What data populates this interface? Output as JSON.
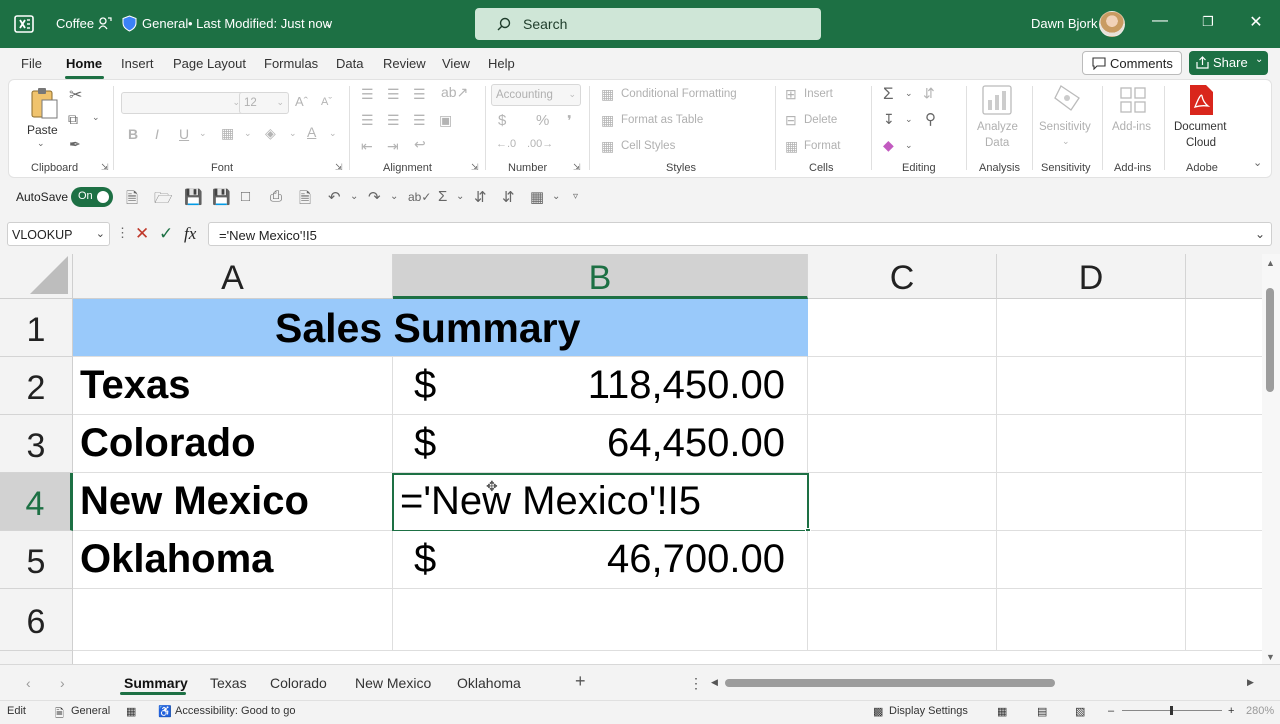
{
  "titlebar": {
    "file_name": "Coffee",
    "sensitivity": "General",
    "modified": "• Last Modified: Just now",
    "search_placeholder": "Search",
    "user_name": "Dawn Bjork"
  },
  "ribbon_tabs": [
    "File",
    "Home",
    "Insert",
    "Page Layout",
    "Formulas",
    "Data",
    "Review",
    "View",
    "Help"
  ],
  "comments_label": "Comments",
  "share_label": "Share",
  "ribbon": {
    "clipboard": {
      "paste": "Paste",
      "label": "Clipboard"
    },
    "font": {
      "size": "12",
      "label": "Font"
    },
    "alignment": {
      "label": "Alignment"
    },
    "number": {
      "format": "Accounting",
      "label": "Number"
    },
    "styles": {
      "conditional": "Conditional Formatting",
      "table": "Format as Table",
      "cell_styles": "Cell Styles",
      "label": "Styles"
    },
    "cells": {
      "insert": "Insert",
      "delete": "Delete",
      "format": "Format",
      "label": "Cells"
    },
    "editing": {
      "label": "Editing"
    },
    "analysis": {
      "btn_line1": "Analyze",
      "btn_line2": "Data",
      "label": "Analysis"
    },
    "sensitivity": {
      "btn": "Sensitivity",
      "label": "Sensitivity"
    },
    "addins": {
      "btn": "Add-ins",
      "label": "Add-ins"
    },
    "adobe": {
      "btn_line1": "Document",
      "btn_line2": "Cloud",
      "label": "Adobe"
    }
  },
  "qat": {
    "autosave": "AutoSave",
    "toggle": "On"
  },
  "formula_bar": {
    "name_box": "VLOOKUP",
    "formula": "='New Mexico'!I5"
  },
  "grid": {
    "columns": [
      "A",
      "B",
      "C",
      "D"
    ],
    "rows": [
      "1",
      "2",
      "3",
      "4",
      "5",
      "6"
    ],
    "title": "Sales Summary",
    "data": [
      {
        "state": "Texas",
        "currency": "$",
        "amount": "118,450.00"
      },
      {
        "state": "Colorado",
        "currency": "$",
        "amount": "64,450.00"
      },
      {
        "state": "New Mexico",
        "editing": "='New Mexico'!I5"
      },
      {
        "state": "Oklahoma",
        "currency": "$",
        "amount": "46,700.00"
      }
    ]
  },
  "sheets": [
    "Summary",
    "Texas",
    "Colorado",
    "New Mexico",
    "Oklahoma"
  ],
  "statusbar": {
    "mode": "Edit",
    "sensitivity": "General",
    "accessibility": "Accessibility: Good to go",
    "display": "Display Settings",
    "zoom": "280%"
  },
  "colors": {
    "excel_green": "#1d7044",
    "title_fill": "#99c9fa"
  }
}
